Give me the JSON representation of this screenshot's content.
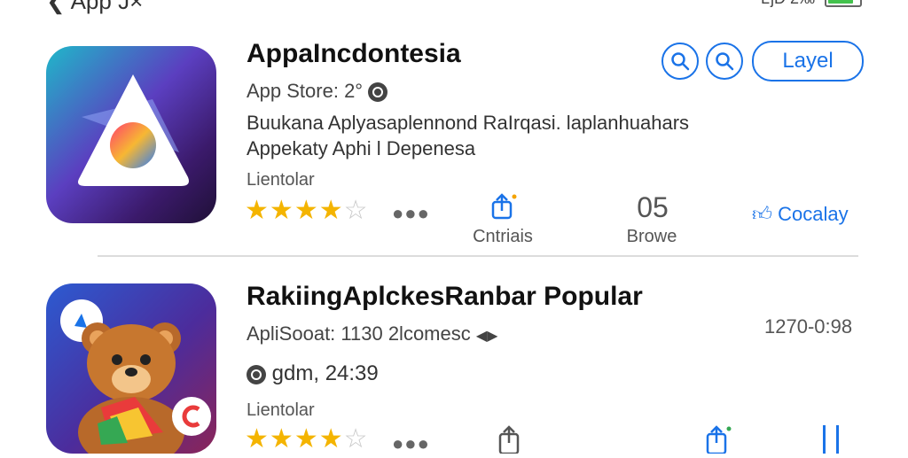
{
  "status_bar": {
    "back_label": "App J×",
    "right_text": "ǈƉ 2‰"
  },
  "colors": {
    "accent": "#1a73e8",
    "star": "#f4b400",
    "battery": "#43c24d"
  },
  "app1": {
    "title": "AppaIncdontesia",
    "store_label": "App Store:  2°",
    "description_line1": "Buukana Aplyasaplennond RaIrqasi. laplanhuahars",
    "description_line2": "Appekaty Aphi l Depenesa",
    "sublabel": "Lientolar",
    "rating": 4,
    "rating_max": 5,
    "more_icon": "more-dots-icon",
    "search_button_1_icon": "search-icon",
    "search_button_2_icon": "search-icon",
    "primary_button": "Layel",
    "action_1_label": "Cntriais",
    "action_2_value": "05",
    "action_2_label": "Browe",
    "action_3_label": "Cocalay"
  },
  "app2": {
    "title": "RakiingAplckesRanbar Popular",
    "store_label": "ApliSooat:  1130 2lcomesc",
    "time_text": "1270-0:98",
    "size_text": "gdm, 24:39",
    "sublabel": "Lientolar",
    "rating": 4,
    "rating_max": 5
  }
}
